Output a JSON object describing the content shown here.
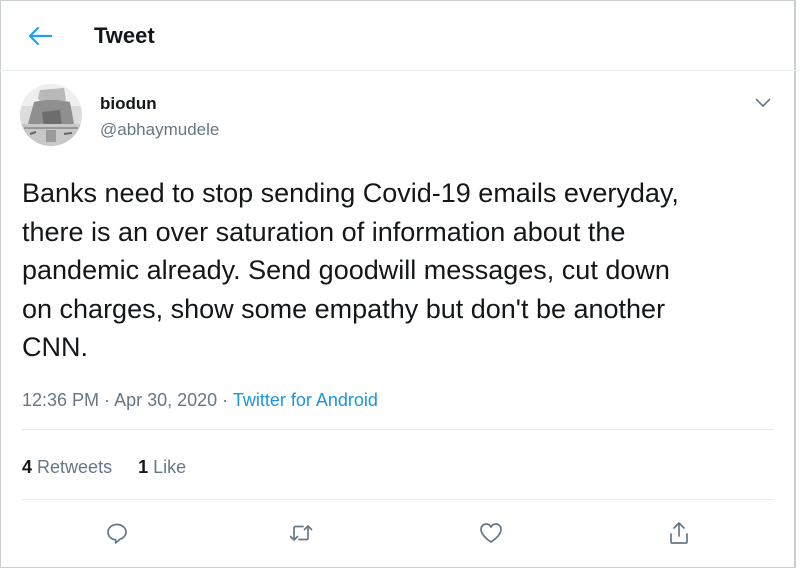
{
  "header": {
    "title": "Tweet",
    "back_icon": "arrow-left-icon"
  },
  "tweet": {
    "author": {
      "name": "biodun",
      "handle": "@abhaymudele",
      "avatar_icon": "profile-photo"
    },
    "menu_icon": "chevron-down-icon",
    "text": "Banks need to stop sending Covid-19 emails everyday,\nthere is an over saturation of information about the\npandemic already. Send goodwill messages, cut down\non charges, show some empathy but don't be another\nCNN.",
    "time": "12:36 PM",
    "separator": " · ",
    "date": "Apr 30, 2020",
    "source": "Twitter for Android"
  },
  "stats": {
    "retweets_count": "4",
    "retweets_label": "Retweets",
    "likes_count": "1",
    "likes_label": "Like"
  },
  "actions": {
    "reply_icon": "reply-icon",
    "retweet_icon": "retweet-icon",
    "like_icon": "heart-icon",
    "share_icon": "share-icon"
  },
  "colors": {
    "accent": "#1da1f2",
    "link": "#1b95e0",
    "secondary_text": "#657786",
    "divider": "#e6ecf0"
  }
}
